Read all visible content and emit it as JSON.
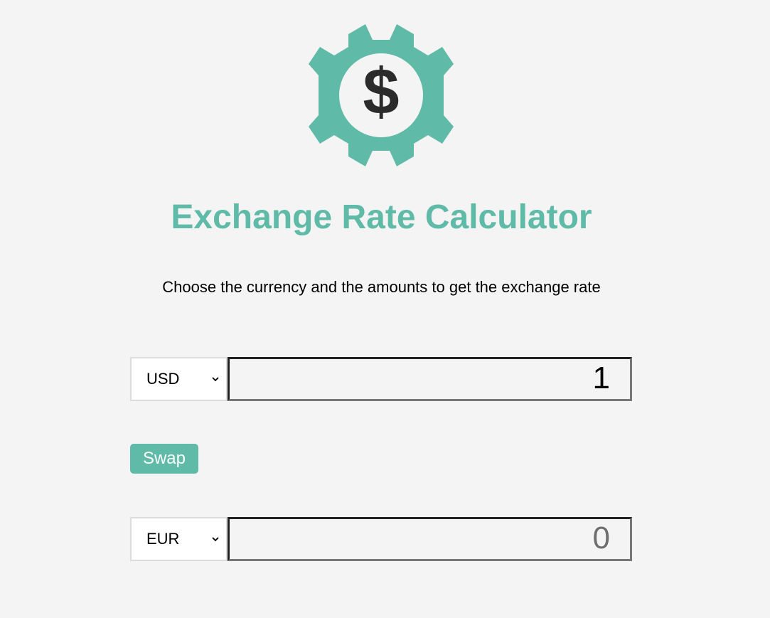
{
  "brand": {
    "accent_color": "#5fbaa7",
    "logo_icon": "dollar-gear-icon"
  },
  "header": {
    "title": "Exchange Rate Calculator",
    "subtitle": "Choose the currency and the amounts to get the exchange rate"
  },
  "from": {
    "currency": "USD",
    "amount": "1"
  },
  "actions": {
    "swap_label": "Swap"
  },
  "to": {
    "currency": "EUR",
    "amount": "0"
  }
}
